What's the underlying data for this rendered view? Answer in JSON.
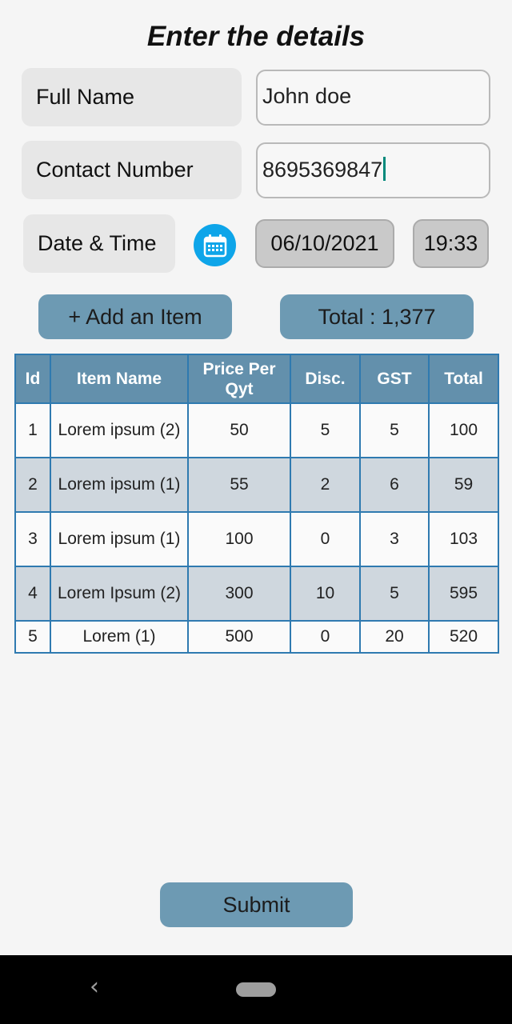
{
  "form": {
    "title": "Enter the details",
    "full_name_label": "Full Name",
    "full_name_value": "John doe",
    "contact_label": "Contact Number",
    "contact_value": "8695369847",
    "datetime_label": "Date & Time",
    "date_value": "06/10/2021",
    "time_value": "19:33",
    "calendar_icon": "calendar-icon"
  },
  "actions": {
    "add_item_label": "+ Add an Item",
    "total_label": "Total : 1,377",
    "submit_label": "Submit"
  },
  "table": {
    "headers": [
      "Id",
      "Item Name",
      "Price Per Qyt",
      "Disc.",
      "GST",
      "Total"
    ],
    "rows": [
      [
        "1",
        "Lorem ipsum (2)",
        "50",
        "5",
        "5",
        "100"
      ],
      [
        "2",
        "Lorem ipsum (1)",
        "55",
        "2",
        "6",
        "59"
      ],
      [
        "3",
        "Lorem ipsum (1)",
        "100",
        "0",
        "3",
        "103"
      ],
      [
        "4",
        "Lorem Ipsum (2)",
        "300",
        "10",
        "5",
        "595"
      ],
      [
        "5",
        "Lorem (1)",
        "500",
        "0",
        "20",
        "520"
      ]
    ]
  },
  "colors": {
    "accent": "#6d9ab3",
    "table_header": "#6390ac",
    "table_border": "#2f7ab0",
    "calendar_button": "#0ea5e9",
    "caret": "#00897b"
  },
  "navigation": {
    "back_icon": "back-icon",
    "home_icon": "home-pill-icon"
  }
}
